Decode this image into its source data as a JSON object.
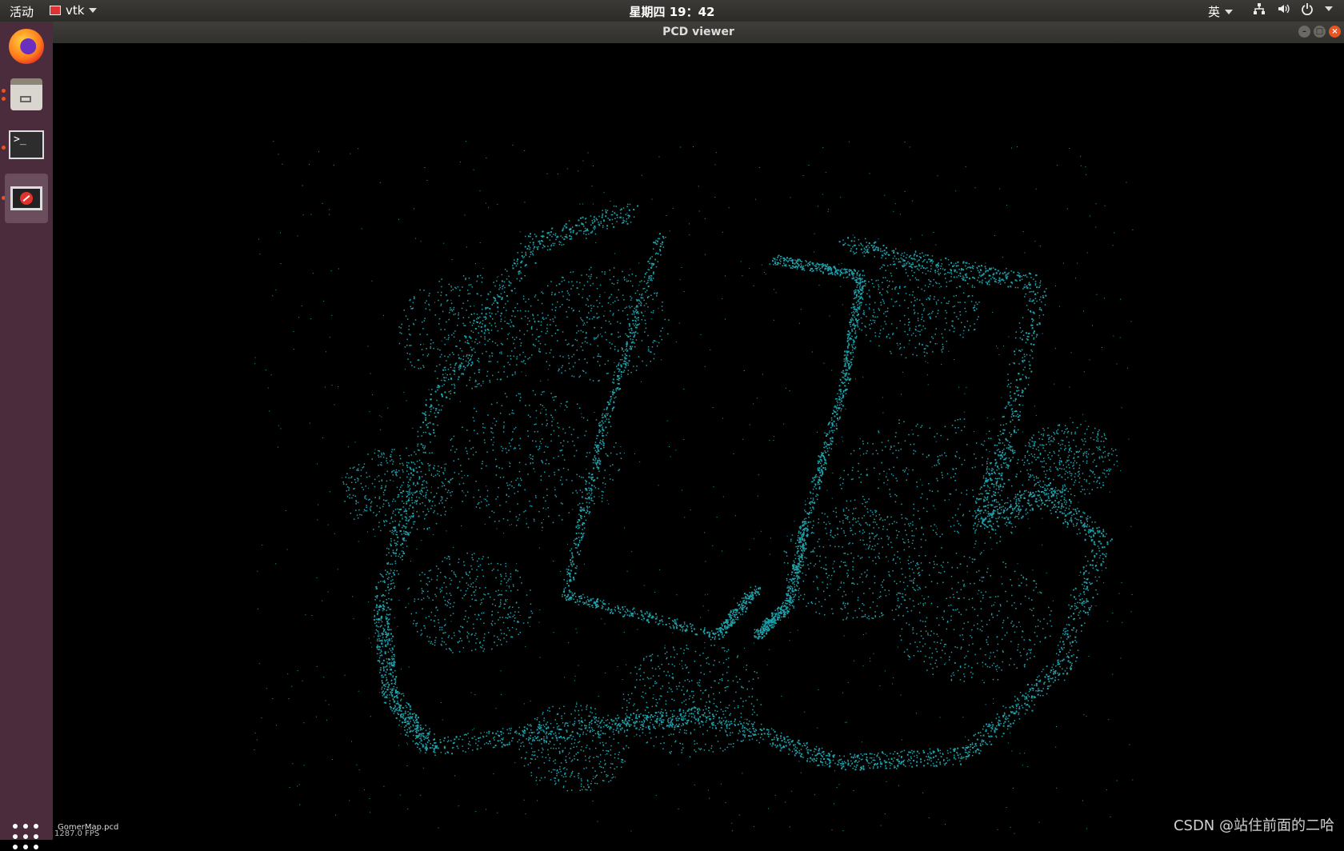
{
  "topbar": {
    "activities": "活动",
    "app_name": "vtk",
    "clock": "星期四 19：42",
    "ime": "英"
  },
  "window": {
    "title": "PCD viewer"
  },
  "viewer": {
    "file_name": "GomerMap.pcd",
    "fps": "1287.0 FPS",
    "point_color": "#1fa0aa"
  },
  "watermark": "CSDN @站住前面的二哈",
  "dock": {
    "items": [
      "firefox-icon",
      "files-icon",
      "terminal-icon",
      "vtk-app-icon"
    ],
    "show_apps": "show-applications-icon"
  },
  "icons": {
    "network": "network-icon",
    "volume": "volume-icon",
    "power": "power-icon"
  }
}
